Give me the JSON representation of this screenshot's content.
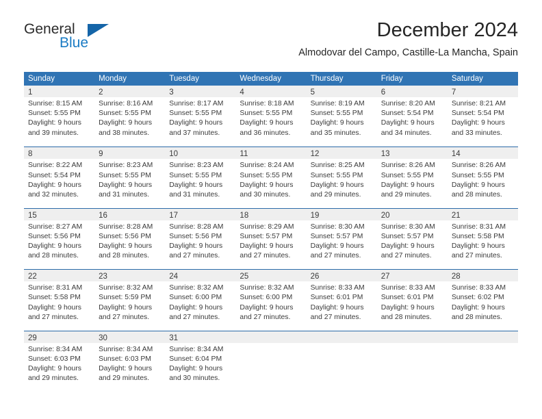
{
  "brand": {
    "name_part1": "General",
    "name_part2": "Blue",
    "accent_color": "#1a7bc4",
    "triangle_color": "#1565a8"
  },
  "header": {
    "title": "December 2024",
    "location": "Almodovar del Campo, Castille-La Mancha, Spain"
  },
  "calendar": {
    "header_background": "#3074b4",
    "row_divider_color": "#2a6aa8",
    "day_band_color": "#efefef",
    "weekdays": [
      "Sunday",
      "Monday",
      "Tuesday",
      "Wednesday",
      "Thursday",
      "Friday",
      "Saturday"
    ],
    "weeks": [
      [
        {
          "day": "1",
          "sunrise": "Sunrise: 8:15 AM",
          "sunset": "Sunset: 5:55 PM",
          "daylight_line1": "Daylight: 9 hours",
          "daylight_line2": "and 39 minutes."
        },
        {
          "day": "2",
          "sunrise": "Sunrise: 8:16 AM",
          "sunset": "Sunset: 5:55 PM",
          "daylight_line1": "Daylight: 9 hours",
          "daylight_line2": "and 38 minutes."
        },
        {
          "day": "3",
          "sunrise": "Sunrise: 8:17 AM",
          "sunset": "Sunset: 5:55 PM",
          "daylight_line1": "Daylight: 9 hours",
          "daylight_line2": "and 37 minutes."
        },
        {
          "day": "4",
          "sunrise": "Sunrise: 8:18 AM",
          "sunset": "Sunset: 5:55 PM",
          "daylight_line1": "Daylight: 9 hours",
          "daylight_line2": "and 36 minutes."
        },
        {
          "day": "5",
          "sunrise": "Sunrise: 8:19 AM",
          "sunset": "Sunset: 5:55 PM",
          "daylight_line1": "Daylight: 9 hours",
          "daylight_line2": "and 35 minutes."
        },
        {
          "day": "6",
          "sunrise": "Sunrise: 8:20 AM",
          "sunset": "Sunset: 5:54 PM",
          "daylight_line1": "Daylight: 9 hours",
          "daylight_line2": "and 34 minutes."
        },
        {
          "day": "7",
          "sunrise": "Sunrise: 8:21 AM",
          "sunset": "Sunset: 5:54 PM",
          "daylight_line1": "Daylight: 9 hours",
          "daylight_line2": "and 33 minutes."
        }
      ],
      [
        {
          "day": "8",
          "sunrise": "Sunrise: 8:22 AM",
          "sunset": "Sunset: 5:54 PM",
          "daylight_line1": "Daylight: 9 hours",
          "daylight_line2": "and 32 minutes."
        },
        {
          "day": "9",
          "sunrise": "Sunrise: 8:23 AM",
          "sunset": "Sunset: 5:55 PM",
          "daylight_line1": "Daylight: 9 hours",
          "daylight_line2": "and 31 minutes."
        },
        {
          "day": "10",
          "sunrise": "Sunrise: 8:23 AM",
          "sunset": "Sunset: 5:55 PM",
          "daylight_line1": "Daylight: 9 hours",
          "daylight_line2": "and 31 minutes."
        },
        {
          "day": "11",
          "sunrise": "Sunrise: 8:24 AM",
          "sunset": "Sunset: 5:55 PM",
          "daylight_line1": "Daylight: 9 hours",
          "daylight_line2": "and 30 minutes."
        },
        {
          "day": "12",
          "sunrise": "Sunrise: 8:25 AM",
          "sunset": "Sunset: 5:55 PM",
          "daylight_line1": "Daylight: 9 hours",
          "daylight_line2": "and 29 minutes."
        },
        {
          "day": "13",
          "sunrise": "Sunrise: 8:26 AM",
          "sunset": "Sunset: 5:55 PM",
          "daylight_line1": "Daylight: 9 hours",
          "daylight_line2": "and 29 minutes."
        },
        {
          "day": "14",
          "sunrise": "Sunrise: 8:26 AM",
          "sunset": "Sunset: 5:55 PM",
          "daylight_line1": "Daylight: 9 hours",
          "daylight_line2": "and 28 minutes."
        }
      ],
      [
        {
          "day": "15",
          "sunrise": "Sunrise: 8:27 AM",
          "sunset": "Sunset: 5:56 PM",
          "daylight_line1": "Daylight: 9 hours",
          "daylight_line2": "and 28 minutes."
        },
        {
          "day": "16",
          "sunrise": "Sunrise: 8:28 AM",
          "sunset": "Sunset: 5:56 PM",
          "daylight_line1": "Daylight: 9 hours",
          "daylight_line2": "and 28 minutes."
        },
        {
          "day": "17",
          "sunrise": "Sunrise: 8:28 AM",
          "sunset": "Sunset: 5:56 PM",
          "daylight_line1": "Daylight: 9 hours",
          "daylight_line2": "and 27 minutes."
        },
        {
          "day": "18",
          "sunrise": "Sunrise: 8:29 AM",
          "sunset": "Sunset: 5:57 PM",
          "daylight_line1": "Daylight: 9 hours",
          "daylight_line2": "and 27 minutes."
        },
        {
          "day": "19",
          "sunrise": "Sunrise: 8:30 AM",
          "sunset": "Sunset: 5:57 PM",
          "daylight_line1": "Daylight: 9 hours",
          "daylight_line2": "and 27 minutes."
        },
        {
          "day": "20",
          "sunrise": "Sunrise: 8:30 AM",
          "sunset": "Sunset: 5:57 PM",
          "daylight_line1": "Daylight: 9 hours",
          "daylight_line2": "and 27 minutes."
        },
        {
          "day": "21",
          "sunrise": "Sunrise: 8:31 AM",
          "sunset": "Sunset: 5:58 PM",
          "daylight_line1": "Daylight: 9 hours",
          "daylight_line2": "and 27 minutes."
        }
      ],
      [
        {
          "day": "22",
          "sunrise": "Sunrise: 8:31 AM",
          "sunset": "Sunset: 5:58 PM",
          "daylight_line1": "Daylight: 9 hours",
          "daylight_line2": "and 27 minutes."
        },
        {
          "day": "23",
          "sunrise": "Sunrise: 8:32 AM",
          "sunset": "Sunset: 5:59 PM",
          "daylight_line1": "Daylight: 9 hours",
          "daylight_line2": "and 27 minutes."
        },
        {
          "day": "24",
          "sunrise": "Sunrise: 8:32 AM",
          "sunset": "Sunset: 6:00 PM",
          "daylight_line1": "Daylight: 9 hours",
          "daylight_line2": "and 27 minutes."
        },
        {
          "day": "25",
          "sunrise": "Sunrise: 8:32 AM",
          "sunset": "Sunset: 6:00 PM",
          "daylight_line1": "Daylight: 9 hours",
          "daylight_line2": "and 27 minutes."
        },
        {
          "day": "26",
          "sunrise": "Sunrise: 8:33 AM",
          "sunset": "Sunset: 6:01 PM",
          "daylight_line1": "Daylight: 9 hours",
          "daylight_line2": "and 27 minutes."
        },
        {
          "day": "27",
          "sunrise": "Sunrise: 8:33 AM",
          "sunset": "Sunset: 6:01 PM",
          "daylight_line1": "Daylight: 9 hours",
          "daylight_line2": "and 28 minutes."
        },
        {
          "day": "28",
          "sunrise": "Sunrise: 8:33 AM",
          "sunset": "Sunset: 6:02 PM",
          "daylight_line1": "Daylight: 9 hours",
          "daylight_line2": "and 28 minutes."
        }
      ],
      [
        {
          "day": "29",
          "sunrise": "Sunrise: 8:34 AM",
          "sunset": "Sunset: 6:03 PM",
          "daylight_line1": "Daylight: 9 hours",
          "daylight_line2": "and 29 minutes."
        },
        {
          "day": "30",
          "sunrise": "Sunrise: 8:34 AM",
          "sunset": "Sunset: 6:03 PM",
          "daylight_line1": "Daylight: 9 hours",
          "daylight_line2": "and 29 minutes."
        },
        {
          "day": "31",
          "sunrise": "Sunrise: 8:34 AM",
          "sunset": "Sunset: 6:04 PM",
          "daylight_line1": "Daylight: 9 hours",
          "daylight_line2": "and 30 minutes."
        },
        {
          "day": "",
          "sunrise": "",
          "sunset": "",
          "daylight_line1": "",
          "daylight_line2": ""
        },
        {
          "day": "",
          "sunrise": "",
          "sunset": "",
          "daylight_line1": "",
          "daylight_line2": ""
        },
        {
          "day": "",
          "sunrise": "",
          "sunset": "",
          "daylight_line1": "",
          "daylight_line2": ""
        },
        {
          "day": "",
          "sunrise": "",
          "sunset": "",
          "daylight_line1": "",
          "daylight_line2": ""
        }
      ]
    ]
  }
}
